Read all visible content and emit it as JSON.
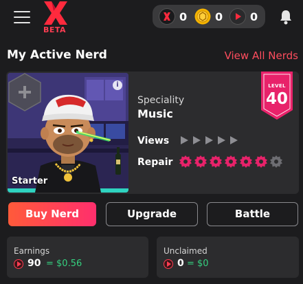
{
  "header": {
    "logo_badge": "BETA",
    "currencies": [
      {
        "icon": "x-token-icon",
        "value": "0"
      },
      {
        "icon": "gold-coin-icon",
        "value": "0"
      },
      {
        "icon": "play-token-icon",
        "value": "0"
      }
    ]
  },
  "section": {
    "title": "My Active Nerd",
    "view_all": "View All Nerds"
  },
  "nerd": {
    "tier": "Starter",
    "info_glyph": "i",
    "speciality_label": "Speciality",
    "speciality": "Music",
    "views_label": "Views",
    "views_icons": 5,
    "repair_label": "Repair",
    "repair_filled": 6,
    "repair_total": 7,
    "level_label": "LEVEL",
    "level": "40"
  },
  "actions": {
    "buy": "Buy Nerd",
    "upgrade": "Upgrade",
    "battle": "Battle"
  },
  "stats": {
    "earnings": {
      "label": "Earnings",
      "amount": "90",
      "usd": "= $0.56"
    },
    "unclaimed": {
      "label": "Unclaimed",
      "amount": "0",
      "usd": "= $0"
    }
  },
  "colors": {
    "accent": "#ff3d52",
    "brand_gradient_start": "#ff5a3a",
    "brand_gradient_end": "#ff2f6d",
    "usd_green": "#35d07f",
    "level_badge": "#e8226a",
    "gold": "#f5b400"
  }
}
